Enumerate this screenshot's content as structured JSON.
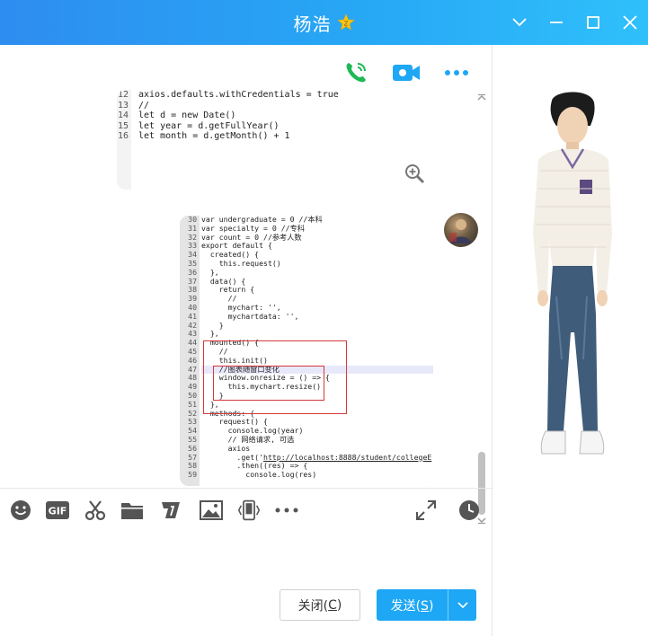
{
  "window": {
    "title": "杨浩",
    "controls": [
      "chevron-down-icon",
      "minimize-icon",
      "maximize-icon",
      "close-icon"
    ]
  },
  "call_bar": {
    "voice_icon": "phone-icon",
    "video_icon": "video-icon",
    "more_icon": "more-icon"
  },
  "messages": {
    "snippet1": {
      "line_numbers": [
        "12",
        "13",
        "14",
        "15",
        "16"
      ],
      "lines": [
        "axios.defaults.withCredentials = true",
        "//",
        "let d = new Date()",
        "let year = d.getFullYear()",
        "let month = d.getMonth() + 1"
      ]
    },
    "snippet2": {
      "line_numbers": [
        "30",
        "31",
        "32",
        "33",
        "34",
        "35",
        "36",
        "37",
        "38",
        "39",
        "40",
        "41",
        "42",
        "43",
        "44",
        "45",
        "46",
        "47",
        "48",
        "49",
        "50",
        "51",
        "52",
        "53",
        "54",
        "55",
        "56",
        "57",
        "58",
        "59"
      ],
      "lines": [
        "var undergraduate = 0 //本科",
        "var specialty = 0 //专科",
        "var count = 0 //参考人数",
        "export default {",
        "  created() {",
        "    this.request()",
        "  },",
        "  data() {",
        "    return {",
        "      //",
        "      mychart: '',",
        "      mychartdata: '',",
        "    }",
        "  },",
        "  mounted() {",
        "    //",
        "    this.init()",
        "    //图表随窗口变化",
        "    window.onresize = () => {",
        "      this.mychart.resize()",
        "    }",
        "  },",
        "  methods: {",
        "    request() {",
        "      console.log(year)",
        "      // 网络请求, 可选",
        "      axios",
        "        .get('http://localhost:8888/student/collegeE",
        "        .then((res) => {",
        "          console.log(res)"
      ]
    }
  },
  "toolbar": {
    "icons": [
      "emoji-icon",
      "gif-icon",
      "scissors-icon",
      "folder-icon",
      "shake-icon",
      "image-icon",
      "screen-share-icon",
      "more-tools-icon",
      "expand-icon",
      "history-icon"
    ]
  },
  "buttons": {
    "close_label": "关闭(",
    "close_key": "C",
    "close_tail": ")",
    "send_label": "发送(",
    "send_key": "S",
    "send_tail": ")"
  },
  "colors": {
    "title_bar": "#2e8df0",
    "accent": "#1ea7f5",
    "highlight_box": "#d63a3a"
  }
}
